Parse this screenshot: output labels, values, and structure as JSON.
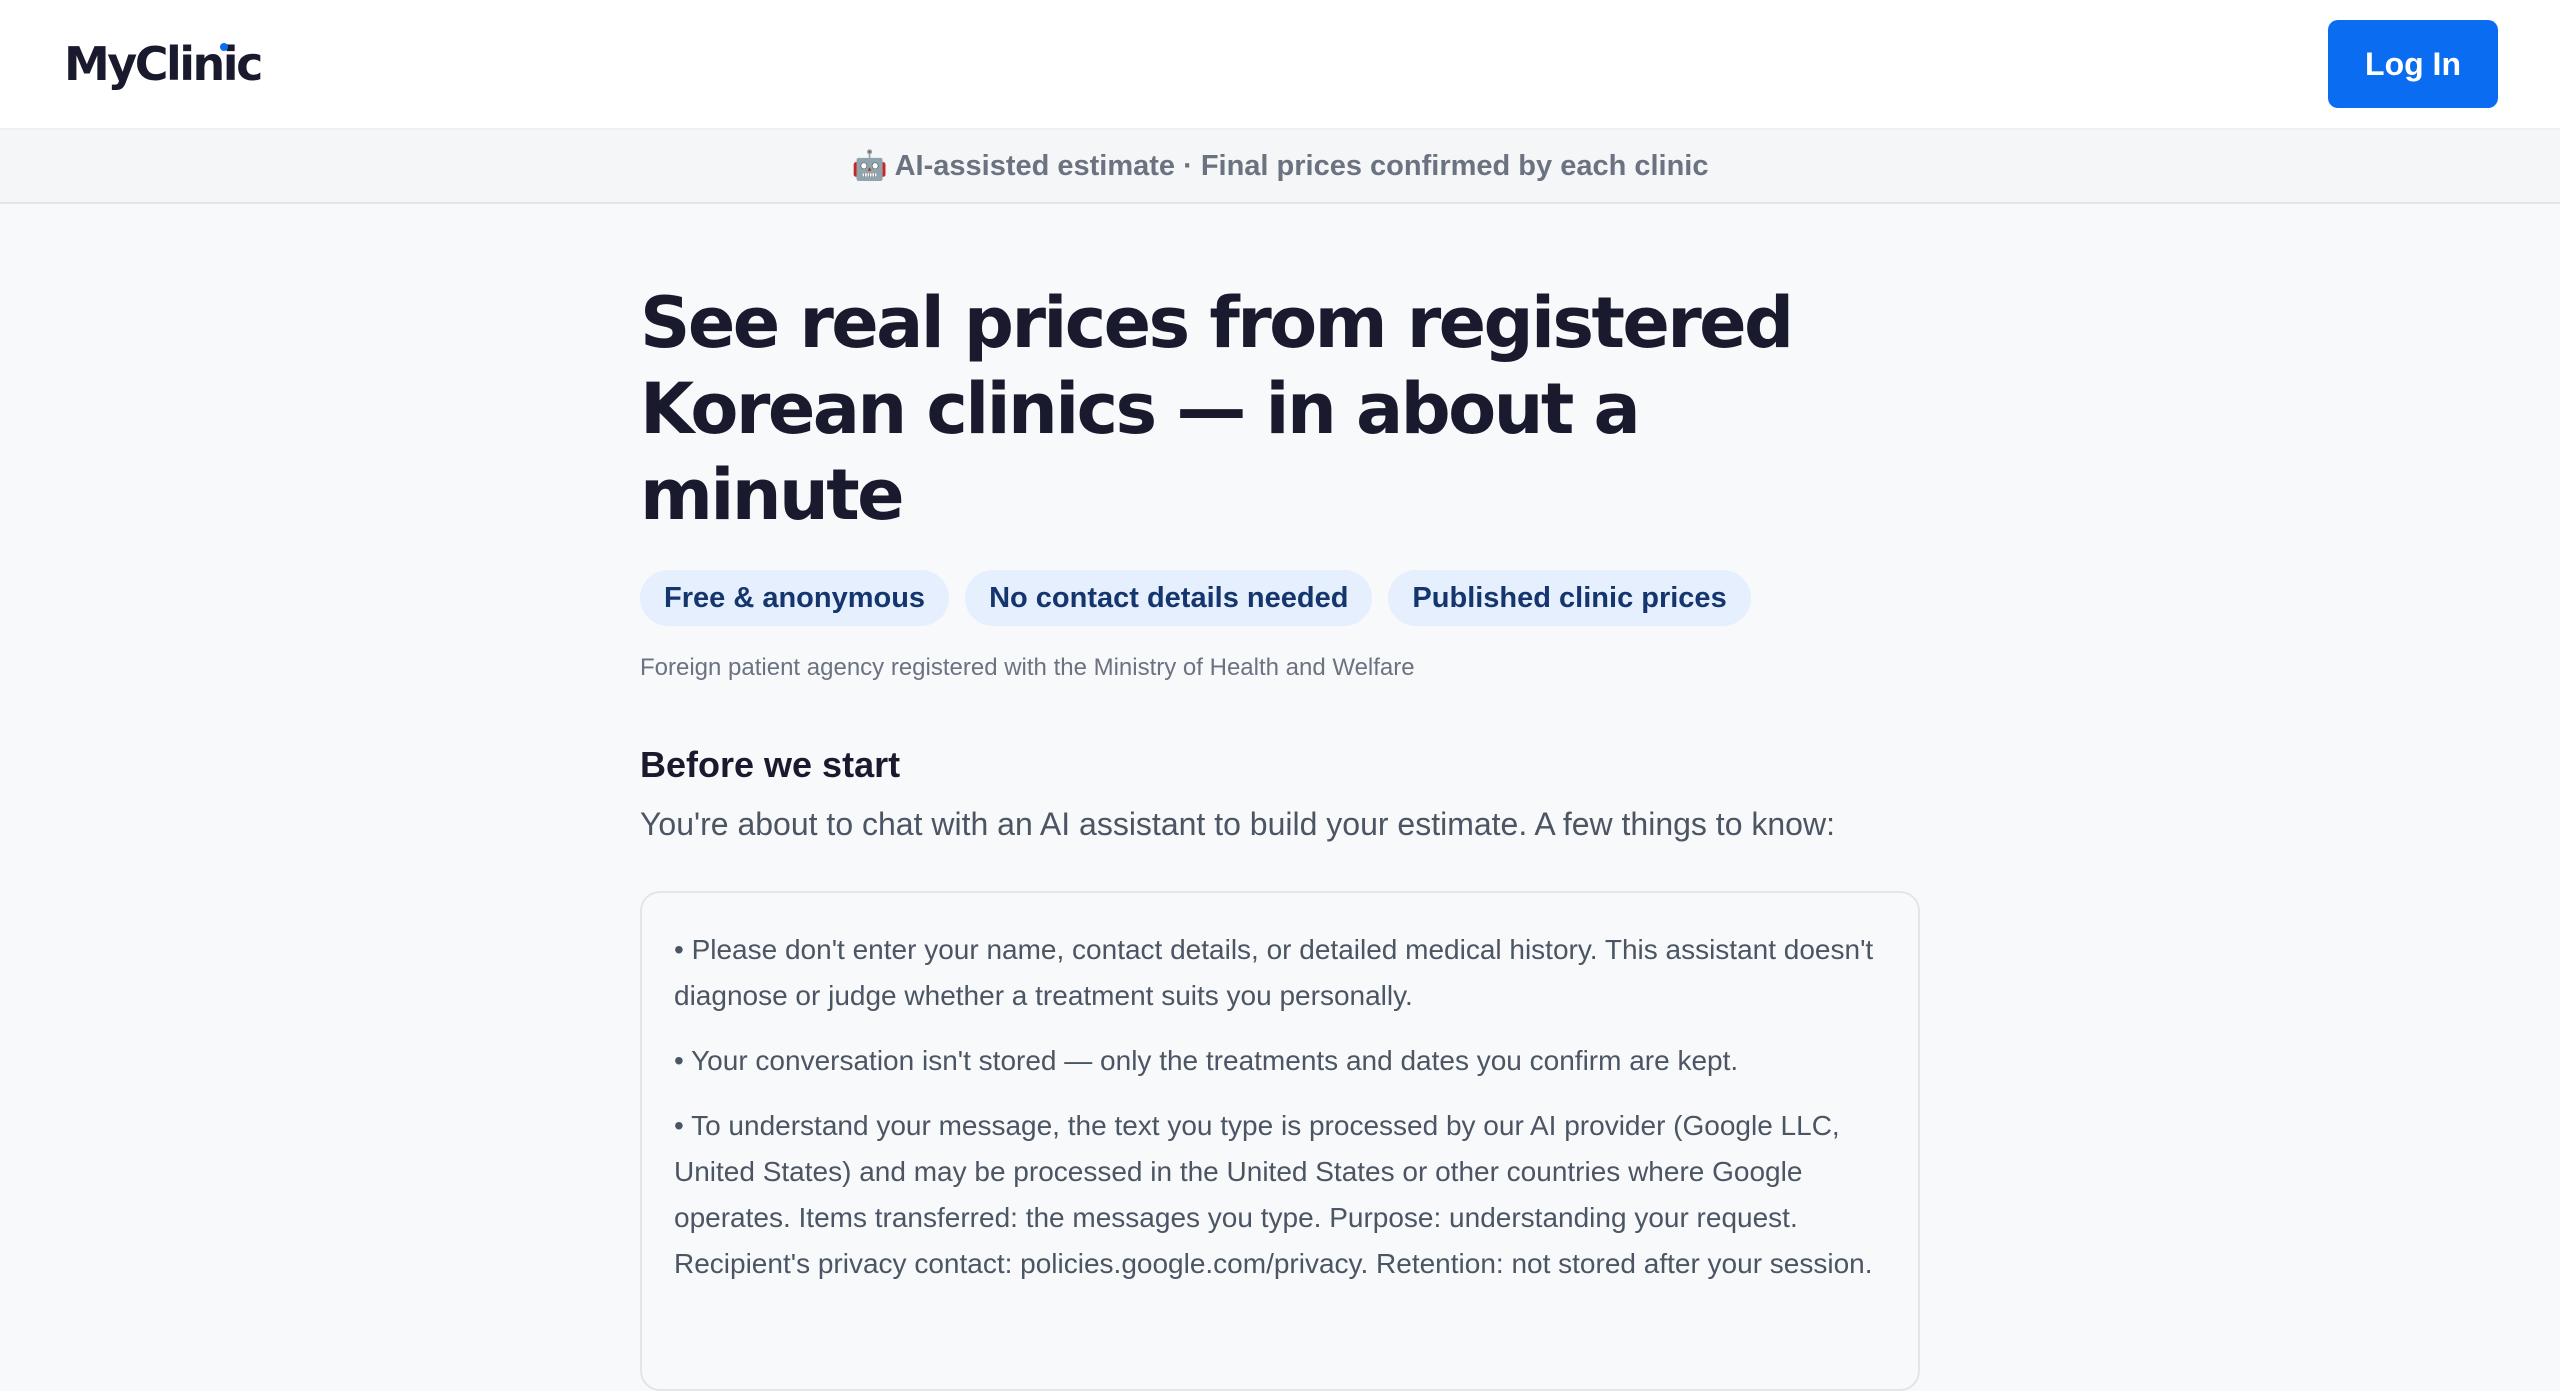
{
  "header": {
    "logo": "MyClinic",
    "login_label": "Log In"
  },
  "notice": {
    "icon": "robot-icon",
    "text": "🤖 AI-assisted estimate · Final prices confirmed by each clinic"
  },
  "hero": {
    "title_line1": "See real prices from registered",
    "title_line2": "Korean clinics — in about a minute",
    "pills": [
      "Free & anonymous",
      "No contact details needed",
      "Published clinic prices"
    ],
    "registered_note": "Foreign patient agency registered with the Ministry of Health and Welfare"
  },
  "intro": {
    "title": "Before we start",
    "subtitle": "You're about to chat with an AI assistant to build your estimate. A few things to know:"
  },
  "info_items": [
    "• Please don't enter your name, contact details, or detailed medical history. This assistant doesn't diagnose or judge whether a treatment suits you personally.",
    "• Your conversation isn't stored — only the treatments and dates you confirm are kept.",
    "• To understand your message, the text you type is processed by our AI provider (Google LLC, United States) and may be processed in the United States or other countries where Google operates. Items transferred: the messages you type. Purpose: understanding your request. Recipient's privacy contact: policies.google.com/privacy. Retention: not stored after your session."
  ],
  "colors": {
    "accent": "#0a6cf0",
    "pill_bg": "#e6effd",
    "pill_text": "#14356e",
    "title": "#1a1a2e",
    "muted": "#6b7280"
  }
}
